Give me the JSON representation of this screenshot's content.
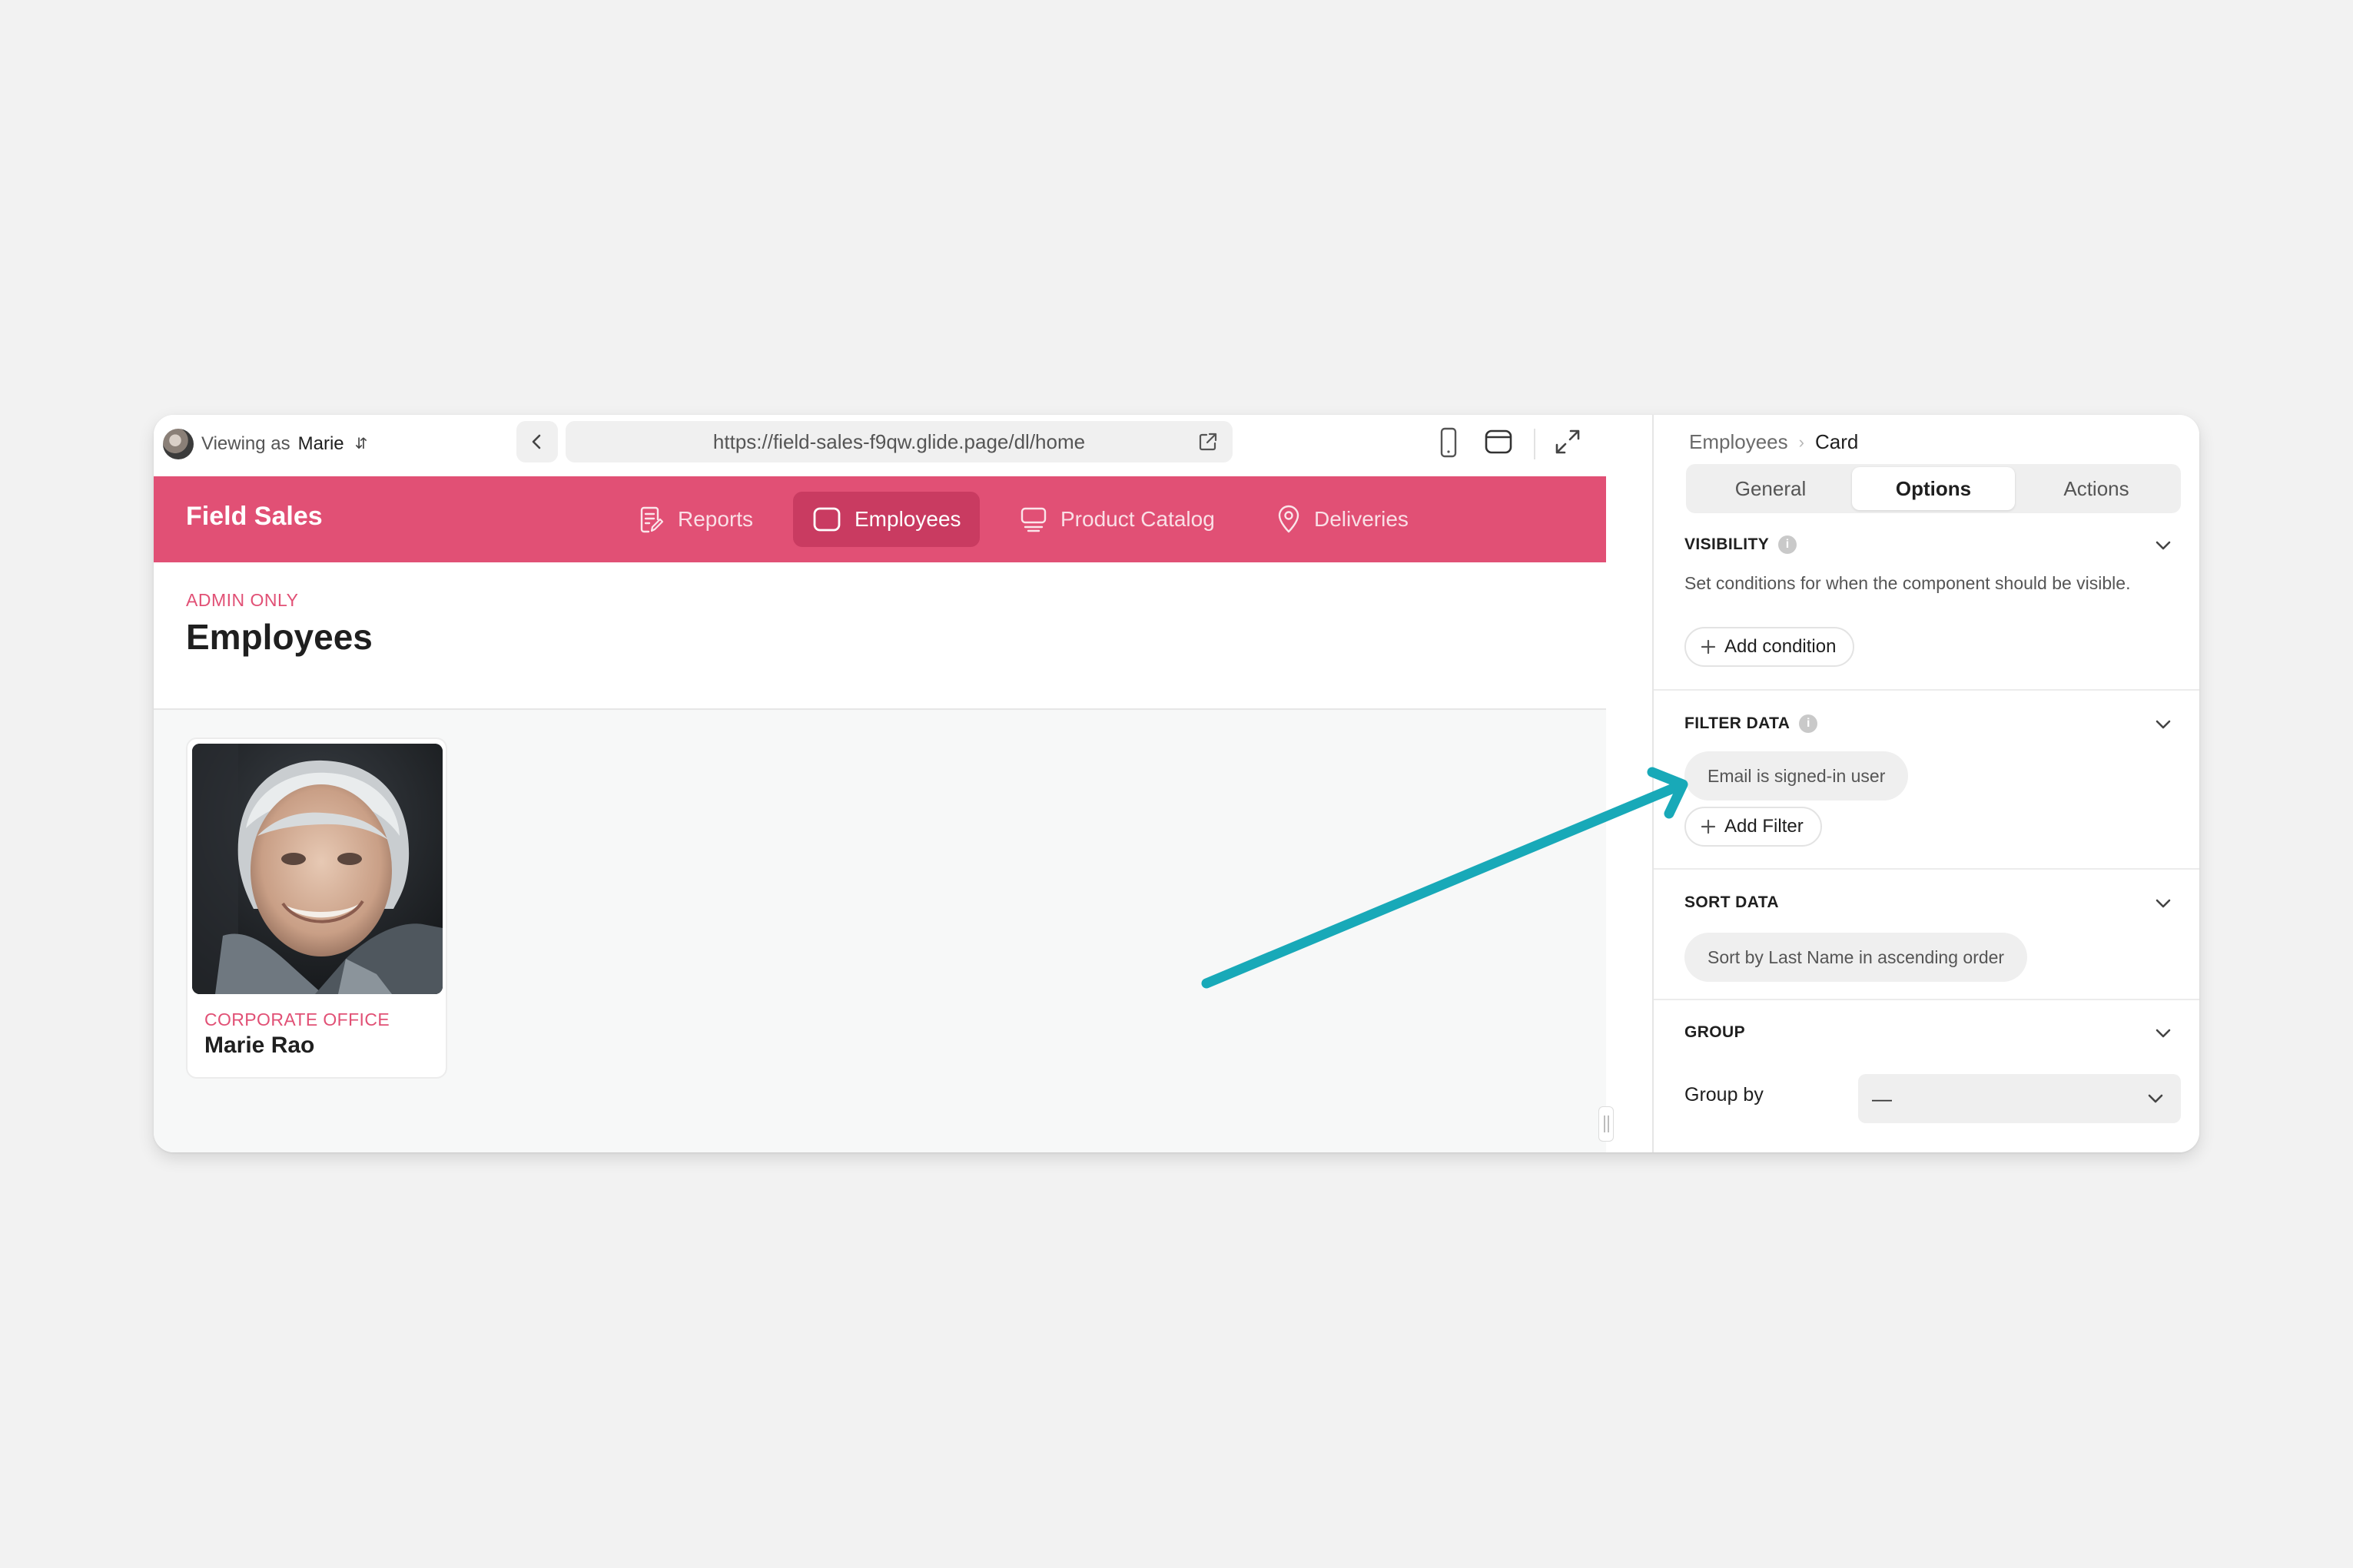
{
  "preview": {
    "viewing_prefix": "Viewing as",
    "viewing_user": "Marie",
    "url": "https://field-sales-f9qw.glide.page/dl/home"
  },
  "app": {
    "title": "Field Sales",
    "nav": [
      {
        "label": "Reports",
        "icon": "reports-icon"
      },
      {
        "label": "Employees",
        "icon": "tablet-icon",
        "active": true
      },
      {
        "label": "Product Catalog",
        "icon": "catalog-icon"
      },
      {
        "label": "Deliveries",
        "icon": "map-pin-icon"
      }
    ],
    "accent": "#e15075"
  },
  "page": {
    "eyebrow": "ADMIN ONLY",
    "title": "Employees"
  },
  "card": {
    "subtitle": "CORPORATE OFFICE",
    "name": "Marie Rao"
  },
  "panel": {
    "breadcrumb": {
      "parent": "Employees",
      "current": "Card"
    },
    "tabs": [
      "General",
      "Options",
      "Actions"
    ],
    "active_tab": "Options",
    "visibility": {
      "heading": "VISIBILITY",
      "description": "Set conditions for when the component should be visible.",
      "button": "Add condition"
    },
    "filter": {
      "heading": "FILTER DATA",
      "chip": "Email is signed-in user",
      "button": "Add Filter"
    },
    "sort": {
      "heading": "SORT DATA",
      "chip": "Sort by Last Name in ascending order"
    },
    "group": {
      "heading": "GROUP",
      "label": "Group by",
      "value": "—"
    }
  },
  "annotation": {
    "color": "#18a9b8"
  }
}
